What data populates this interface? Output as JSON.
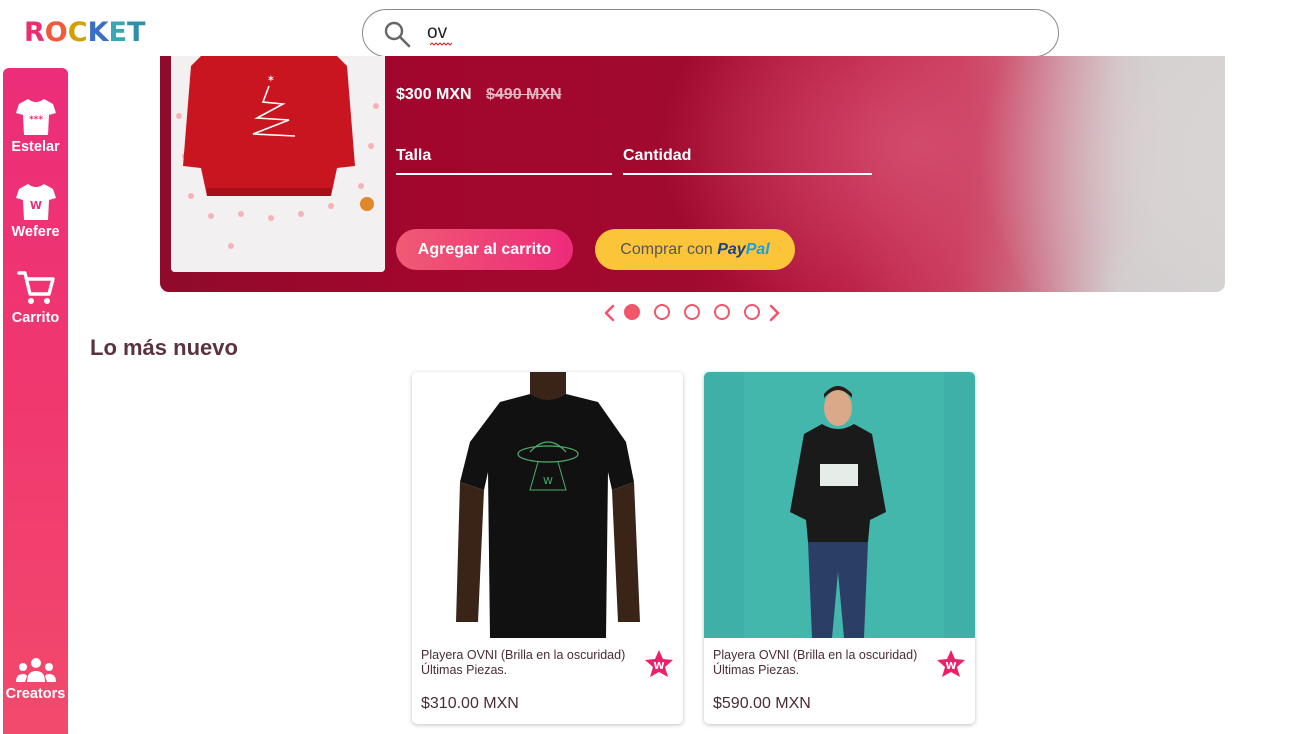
{
  "header": {
    "logo_letters": [
      "R",
      "O",
      "C",
      "K",
      "E",
      "T"
    ],
    "logo_colors": [
      "#ee2d6e",
      "#f25a3a",
      "#f5a623",
      "#3a7bd5",
      "#5cc3c8",
      "#4aa8b8"
    ],
    "search_value": "ov"
  },
  "sidebar": {
    "items": [
      {
        "label": "Estelar",
        "icon": "tshirt-stars-icon"
      },
      {
        "label": "Wefere",
        "icon": "tshirt-w-icon"
      },
      {
        "label": "Carrito",
        "icon": "cart-icon"
      },
      {
        "label": "Creators",
        "icon": "people-group-icon"
      }
    ]
  },
  "banner": {
    "price": "$300 MXN",
    "price_old": "$490 MXN",
    "size_label": "Talla",
    "quantity_label": "Cantidad",
    "add_to_cart": "Agregar al carrito",
    "buy_with": "Comprar con ",
    "paypal_1": "Pay",
    "paypal_2": "Pal"
  },
  "carousel": {
    "total_slides": 5,
    "active_index": 0
  },
  "section": {
    "title": "Lo más nuevo"
  },
  "products": [
    {
      "title": "Playera OVNI (Brilla en la oscuridad) Últimas Piezas.",
      "price": "$310.00 MXN",
      "badge_letter": "W"
    },
    {
      "title": "Playera OVNI (Brilla en la oscuridad) Últimas Piezas.",
      "price": "$590.00 MXN",
      "badge_letter": "W"
    }
  ],
  "colors": {
    "accent": "#f2566b",
    "sidebar": "#ec2d7a",
    "banner": "#a3062d",
    "paypal_button": "#fcc439",
    "title_text": "#5a3340"
  }
}
